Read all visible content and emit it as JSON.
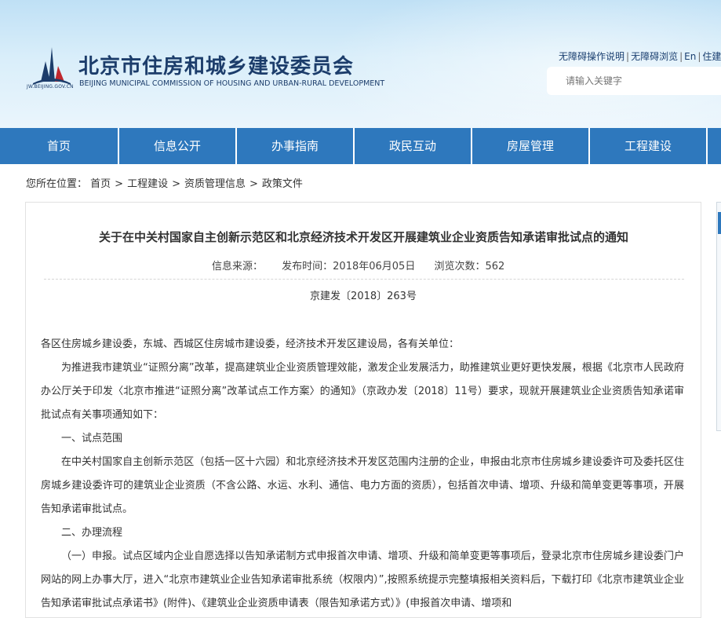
{
  "header": {
    "logo_small": "JW.BEIJING.GOV.CN",
    "title_cn": "北京市住房和城乡建设委员会",
    "title_en": "BEIJING MUNICIPAL COMMISSION OF HOUSING AND URBAN-RURAL DEVELOPMENT",
    "links": [
      "无障碍操作说明",
      "无障碍浏览",
      "En",
      "住建"
    ],
    "search_placeholder": "请输入关键字"
  },
  "nav": {
    "items": [
      "首页",
      "信息公开",
      "办事指南",
      "政民互动",
      "房屋管理",
      "工程建设"
    ]
  },
  "breadcrumb": {
    "label": "您所在位置：",
    "items": [
      "首页",
      "工程建设",
      "资质管理信息",
      "政策文件"
    ],
    "separator": ">"
  },
  "article": {
    "title": "关于在中关村国家自主创新示范区和北京经济技术开发区开展建筑业企业资质告知承诺审批试点的通知",
    "source": "信息来源：",
    "publish_time": "发布时间：2018年06月05日",
    "views": "浏览次数：562",
    "doc_number": "京建发〔2018〕263号",
    "paragraphs": [
      "各区住房城乡建设委，东城、西城区住房城市建设委，经济技术开发区建设局，各有关单位：",
      "为推进我市建筑业“证照分离”改革，提高建筑业企业资质管理效能，激发企业发展活力，助推建筑业更好更快发展，根据《北京市人民政府办公厅关于印发〈北京市推进“证照分离”改革试点工作方案〉的通知》（京政办发〔2018〕11号）要求，现就开展建筑业企业资质告知承诺审批试点有关事项通知如下：",
      "一、试点范围",
      "在中关村国家自主创新示范区（包括一区十六园）和北京经济技术开发区范围内注册的企业，申报由北京市住房城乡建设委许可及委托区住房城乡建设委许可的建筑业企业资质（不含公路、水运、水利、通信、电力方面的资质），包括首次申请、增项、升级和简单变更等事项，开展告知承诺审批试点。",
      "二、办理流程",
      "（一）申报。试点区域内企业自愿选择以告知承诺制方式申报首次申请、增项、升级和简单变更等事项后，登录北京市住房城乡建设委门户网站的网上办事大厅，进入“北京市建筑业企业告知承诺审批系统（权限内）”,按照系统提示完整填报相关资料后，下载打印《北京市建筑业企业告知承诺审批试点承诺书》(附件)、《建筑业企业资质申请表（限告知承诺方式）》(申报首次申请、增项和"
    ]
  }
}
